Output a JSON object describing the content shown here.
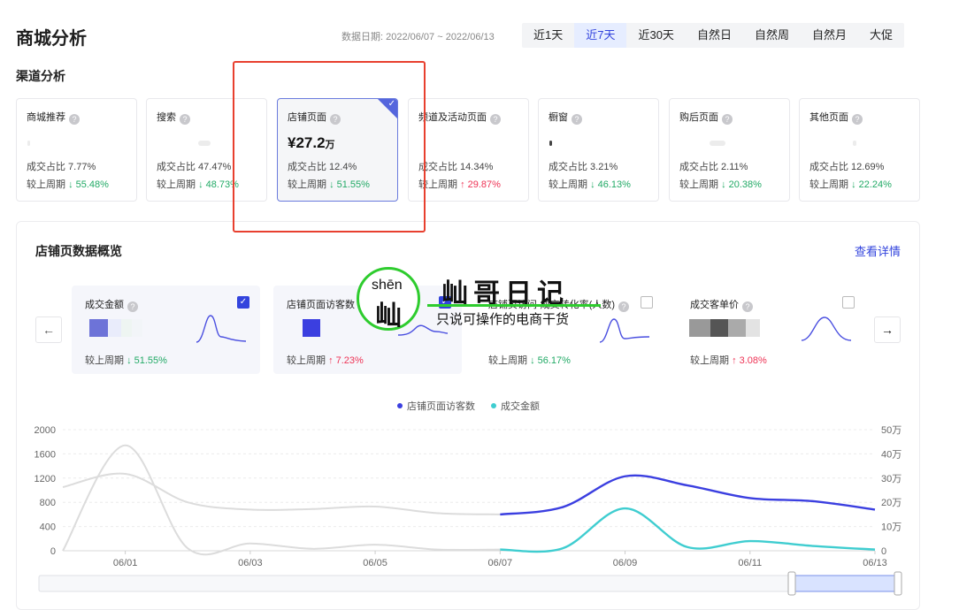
{
  "header": {
    "title": "商城分析",
    "date_range": "数据日期: 2022/06/07 ~ 2022/06/13",
    "tabs": [
      "近1天",
      "近7天",
      "近30天",
      "自然日",
      "自然周",
      "自然月",
      "大促"
    ],
    "active_tab": "近7天"
  },
  "channel_section": {
    "title": "渠道分析",
    "cards": [
      {
        "name": "商城推荐",
        "amount": "",
        "share": "成交占比 7.77%",
        "period_label": "较上周期",
        "period_value": "↓ 55.48%",
        "direction": "down"
      },
      {
        "name": "搜索",
        "amount": "",
        "share": "成交占比 47.47%",
        "period_label": "较上周期",
        "period_value": "↓ 48.73%",
        "direction": "down"
      },
      {
        "name": "店铺页面",
        "amount": "¥27.2",
        "amount_unit": "万",
        "share": "成交占比 12.4%",
        "period_label": "较上周期",
        "period_value": "↓ 51.55%",
        "direction": "down",
        "selected": true
      },
      {
        "name": "频道及活动页面",
        "amount": "",
        "share": "成交占比 14.34%",
        "period_label": "较上周期",
        "period_value": "↑ 29.87%",
        "direction": "up"
      },
      {
        "name": "橱窗",
        "amount": "",
        "share": "成交占比 3.21%",
        "period_label": "较上周期",
        "period_value": "↓ 46.13%",
        "direction": "down"
      },
      {
        "name": "购后页面",
        "amount": "",
        "share": "成交占比 2.11%",
        "period_label": "较上周期",
        "period_value": "↓ 20.38%",
        "direction": "down"
      },
      {
        "name": "其他页面",
        "amount": "",
        "share": "成交占比 12.69%",
        "period_label": "较上周期",
        "period_value": "↓ 22.24%",
        "direction": "down"
      }
    ]
  },
  "overview": {
    "title": "店铺页数据概览",
    "detail_link": "查看详情",
    "prev_icon": "arrow-left-icon",
    "next_icon": "arrow-right-icon",
    "metrics": [
      {
        "name": "成交金额",
        "checked": true,
        "period_label": "较上周期",
        "period_value": "↓ 51.55%",
        "direction": "down"
      },
      {
        "name": "店铺页面访客数",
        "checked": true,
        "period_label": "较上周期",
        "period_value": "↑ 7.23%",
        "direction": "up"
      },
      {
        "name": "店铺页访问-成交转化率(人数)",
        "checked": false,
        "period_label": "较上周期",
        "period_value": "↓ 56.17%",
        "direction": "down"
      },
      {
        "name": "成交客单价",
        "checked": false,
        "period_label": "较上周期",
        "period_value": "↑ 3.08%",
        "direction": "up"
      }
    ]
  },
  "watermark": {
    "pinyin": "shēn",
    "char": "屾",
    "main": "屾哥日记",
    "sub": "只说可操作的电商干货"
  },
  "colors": {
    "accent": "#3344dd",
    "visitors_series": "#3b3fe0",
    "amount_series": "#3fcdd0",
    "previous_period": "#dcdcdc",
    "annotation": "#e8402f",
    "watermark_green": "#2ecc2e"
  },
  "chart_data": {
    "type": "line",
    "legend": [
      "店铺页面访客数",
      "成交金额"
    ],
    "legend_position": "top-center",
    "grid": true,
    "x": [
      "05/31",
      "06/01",
      "06/02",
      "06/03",
      "06/04",
      "06/05",
      "06/06",
      "06/07",
      "06/08",
      "06/09",
      "06/10",
      "06/11",
      "06/12",
      "06/13"
    ],
    "x_tick_labels": [
      "06/01",
      "06/03",
      "06/05",
      "06/07",
      "06/09",
      "06/11",
      "06/13"
    ],
    "y_left": {
      "ticks": [
        "0",
        "400",
        "800",
        "1200",
        "1600",
        "2000"
      ],
      "range": [
        0,
        2000
      ]
    },
    "y_right": {
      "ticks": [
        "0",
        "10万",
        "20万",
        "30万",
        "40万",
        "50万"
      ],
      "range": [
        0,
        500000
      ]
    },
    "series": [
      {
        "name": "店铺页面访客数",
        "axis": "left",
        "x": [
          "06/07",
          "06/08",
          "06/09",
          "06/10",
          "06/11",
          "06/12",
          "06/13"
        ],
        "values": [
          600,
          720,
          1230,
          1080,
          870,
          820,
          680
        ]
      },
      {
        "name": "成交金额",
        "axis": "right",
        "x": [
          "06/07",
          "06/08",
          "06/09",
          "06/10",
          "06/11",
          "06/12",
          "06/13"
        ],
        "values": [
          5000,
          10000,
          175000,
          15000,
          40000,
          20000,
          5000
        ]
      },
      {
        "axis": "left",
        "x": [
          "05/31",
          "06/01",
          "06/02",
          "06/03",
          "06/04",
          "06/05",
          "06/06",
          "06/07"
        ],
        "values": [
          1050,
          1270,
          800,
          680,
          690,
          730,
          620,
          600
        ]
      },
      {
        "axis": "right",
        "x": [
          "05/31",
          "06/01",
          "06/02",
          "06/03",
          "06/04",
          "06/05",
          "06/06",
          "06/07"
        ],
        "values": [
          0,
          435000,
          10000,
          30000,
          8000,
          25000,
          5000,
          5000
        ]
      }
    ]
  }
}
